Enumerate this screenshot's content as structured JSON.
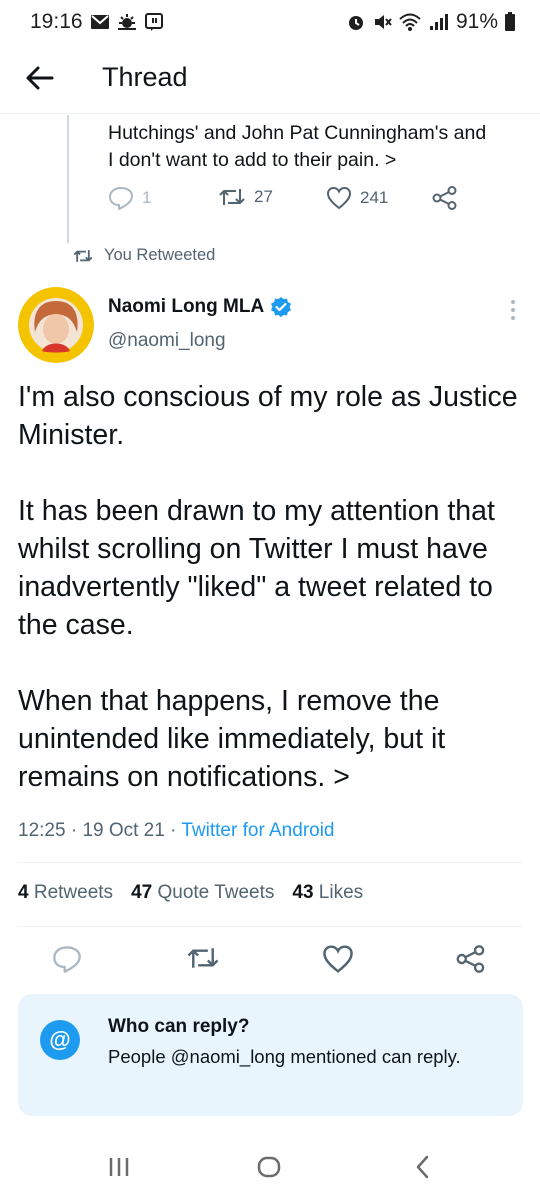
{
  "status_bar": {
    "time": "19:16",
    "battery": "91%"
  },
  "header": {
    "title": "Thread"
  },
  "previous_tweet": {
    "text_line1": "Hutchings' and John Pat Cunningham's and",
    "text_line2": "I don't want to add to their pain. >",
    "replies": "1",
    "retweets": "27",
    "likes": "241"
  },
  "retweet_context": {
    "label": "You Retweeted"
  },
  "tweet": {
    "author_name": "Naomi Long MLA",
    "handle": "@naomi_long",
    "paragraphs": [
      "I'm also conscious of my role as Justice Minister.",
      "It has been drawn to my attention that whilst scrolling on Twitter I must have inadvertently \"liked\" a tweet related to the case.",
      "When that happens, I remove the unintended like immediately, but it remains on notifications. >"
    ],
    "time": "12:25",
    "date": "19 Oct 21",
    "source": "Twitter for Android",
    "stats": {
      "retweets_count": "4",
      "retweets_label": "Retweets",
      "quotes_count": "47",
      "quotes_label": "Quote Tweets",
      "likes_count": "43",
      "likes_label": "Likes"
    }
  },
  "reply_settings": {
    "title": "Who can reply?",
    "text": "People @naomi_long mentioned can reply.",
    "icon_symbol": "@"
  },
  "colors": {
    "accent": "#1d9bf0",
    "muted_text": "#536471",
    "primary_text": "#0f1419",
    "reply_card_bg": "#e8f5fd",
    "verified": "#1d9bf0"
  },
  "icons": {
    "back": "arrow-left-icon",
    "verified": "verified-badge-icon",
    "more": "more-vertical-icon",
    "reply": "reply-icon",
    "retweet": "retweet-icon",
    "like": "heart-icon",
    "share": "share-icon"
  }
}
